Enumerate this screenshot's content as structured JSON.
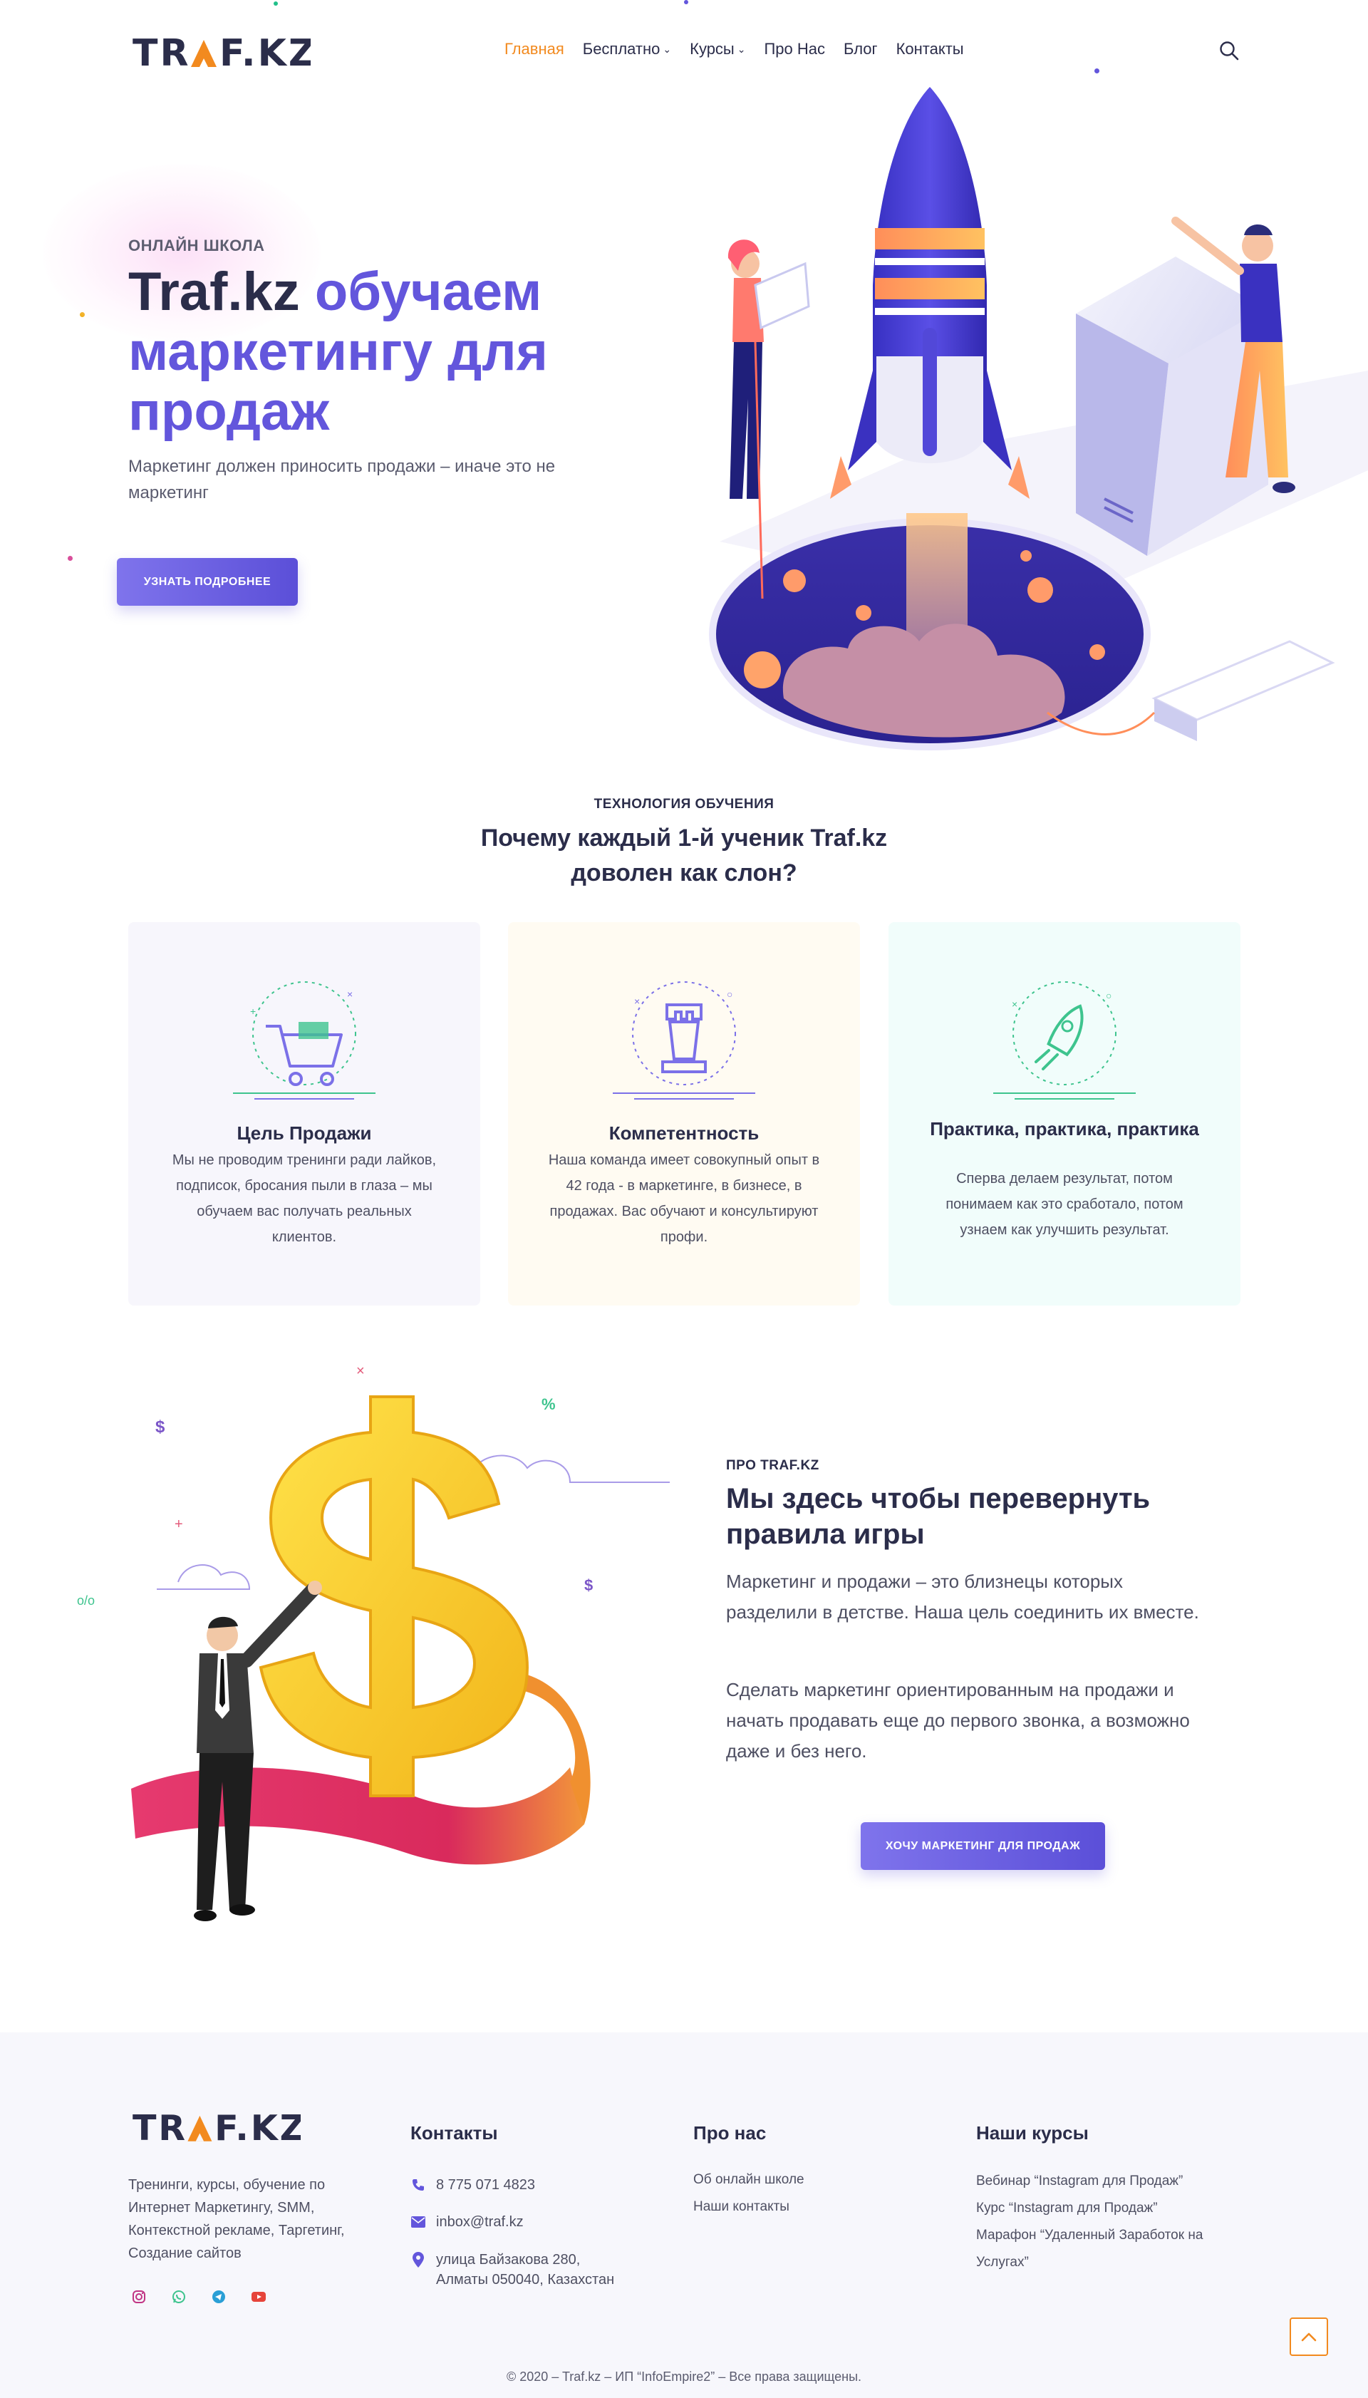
{
  "brand": {
    "logo_text": "TRAF.KZ"
  },
  "nav": {
    "items": [
      {
        "label": "Главная",
        "active": true,
        "dropdown": false
      },
      {
        "label": "Бесплатно",
        "active": false,
        "dropdown": true
      },
      {
        "label": "Курсы",
        "active": false,
        "dropdown": true
      },
      {
        "label": "Про Нас",
        "active": false,
        "dropdown": false
      },
      {
        "label": "Блог",
        "active": false,
        "dropdown": false
      },
      {
        "label": "Контакты",
        "active": false,
        "dropdown": false
      }
    ],
    "search_icon": "search-icon"
  },
  "hero": {
    "kicker": "ОНЛАЙН ШКОЛА",
    "title_brand": "Traf.kz",
    "title_rest": " обучаем маркетингу для продаж",
    "subtitle": "Маркетинг должен приносить продажи – иначе это не маркетинг",
    "button": "УЗНАТЬ ПОДРОБНЕЕ"
  },
  "features": {
    "kicker": "ТЕХНОЛОГИЯ ОБУЧЕНИЯ",
    "title": "Почему каждый 1-й ученик Traf.kz доволен как слон?",
    "cards": [
      {
        "icon": "shopping-cart-icon",
        "title": "Цель Продажи",
        "text": "Мы не проводим тренинги ради лайков, подписок, бросания пыли в глаза – мы обучаем вас получать реальных клиентов."
      },
      {
        "icon": "chess-rook-icon",
        "title": "Компетентность",
        "text": "Наша команда имеет совокупный опыт в 42 года - в маркетинге, в бизнесе, в продажах. Вас обучают и консультируют профи."
      },
      {
        "icon": "rocket-icon",
        "title": "Практика, практика, практика",
        "text": "Сперва делаем результат, потом понимаем как это сработало, потом узнаем как улучшить результат."
      }
    ]
  },
  "about": {
    "kicker": "ПРО TRAF.KZ",
    "title": "Мы здесь чтобы перевернуть правила игры",
    "p1": "Маркетинг и продажи – это близнецы которых разделили в детстве. Наша цель соединить их вместе.",
    "p2": "Сделать маркетинг ориентированным на продажи и начать продавать еще до первого звонка, а возможно даже и без него.",
    "button": "ХОЧУ МАРКЕТИНГ ДЛЯ ПРОДАЖ",
    "art_symbols": [
      "$",
      "%",
      "$",
      "o/o",
      "×",
      "+"
    ]
  },
  "footer": {
    "description": "Тренинги, курсы, обучение по Интернет Маркетингу, SMM, Контекстной рекламе, Таргетинг, Создание сайтов",
    "social": [
      "instagram-icon",
      "whatsapp-icon",
      "telegram-icon",
      "youtube-icon"
    ],
    "contacts_title": "Контакты",
    "phone": "8 775 071 4823",
    "email": "inbox@traf.kz",
    "address": "улица Байзакова 280, Алматы 050040, Казахстан",
    "about_title": "Про нас",
    "about_links": [
      "Об онлайн школе",
      "Наши контакты"
    ],
    "courses_title": "Наши курсы",
    "courses_links": [
      "Вебинар “Instagram для Продаж”",
      "Курс “Instagram для Продаж”",
      "Марафон “Удаленный Заработок на Услугах”"
    ],
    "copyright": "© 2020 – Traf.kz – ИП “InfoEmpire2” – Все права защищены."
  },
  "colors": {
    "accent": "#6356dc",
    "active_nav": "#f28a1f",
    "dark": "#2b2d4a"
  }
}
